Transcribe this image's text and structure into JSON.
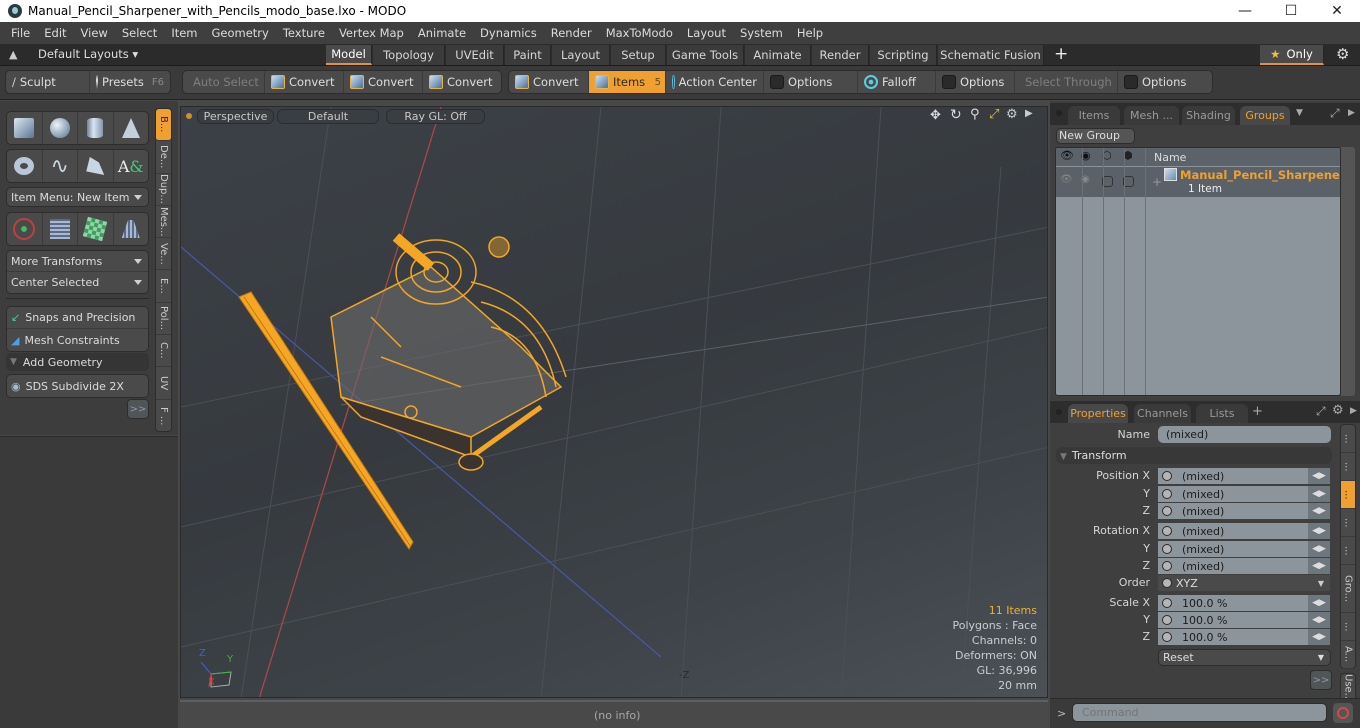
{
  "window": {
    "title": "Manual_Pencil_Sharpener_with_Pencils_modo_base.lxo - MODO",
    "controls": [
      "minimize",
      "maximize",
      "close"
    ]
  },
  "menubar": [
    "File",
    "Edit",
    "View",
    "Select",
    "Item",
    "Geometry",
    "Texture",
    "Vertex Map",
    "Animate",
    "Dynamics",
    "Render",
    "MaxToModo",
    "Layout",
    "System",
    "Help"
  ],
  "layout_bar": {
    "layouts_label": "Default Layouts",
    "tabs": [
      "Model",
      "Topology",
      "UVEdit",
      "Paint",
      "Layout",
      "Setup",
      "Game Tools",
      "Animate",
      "Render",
      "Scripting",
      "Schematic Fusion"
    ],
    "active_tab": "Model",
    "add_label": "+",
    "only_label": "Only"
  },
  "toolbar": {
    "sculpt": "Sculpt",
    "presets": "Presets",
    "presets_hotkey": "F6",
    "auto_select": "Auto Select",
    "convert1": "Convert",
    "convert2": "Convert",
    "convert3": "Convert",
    "convert4": "Convert",
    "items": "Items",
    "items_count": "5",
    "action_center": "Action Center",
    "options1": "Options",
    "falloff": "Falloff",
    "options2": "Options",
    "select_through": "Select Through",
    "options3": "Options"
  },
  "left_panel": {
    "item_menu": "Item Menu: New Item",
    "more_transforms": "More Transforms",
    "center_selected": "Center Selected",
    "snaps": "Snaps and Precision",
    "mesh_constraints": "Mesh Constraints",
    "add_geometry": "Add Geometry",
    "sds_subdivide": "SDS Subdivide 2X",
    "more": ">>",
    "vertical_tabs": [
      "B...",
      "De...",
      "Dup...",
      "Mes...",
      "Ve...",
      "E...",
      "Pol...",
      "C...",
      "UV",
      "F ..."
    ]
  },
  "viewport": {
    "view": "Perspective",
    "shading": "Default",
    "raygl": "Ray GL: Off",
    "stats": {
      "items": "11 Items",
      "polygons": "Polygons : Face",
      "channels": "Channels: 0",
      "deformers": "Deformers: ON",
      "gl": "GL: 36,996",
      "scale": "20 mm"
    },
    "axis_labels": {
      "x": "X",
      "y": "Y",
      "z": "Z",
      "neg_z": "-Z"
    }
  },
  "status_bar": {
    "info": "(no info)"
  },
  "items_panel": {
    "tabs": [
      "Items",
      "Mesh ...",
      "Shading",
      "Groups"
    ],
    "active_tab": "Groups",
    "new_group": "New Group",
    "column_name": "Name",
    "rows": [
      {
        "name": "Manual_Pencil_Sharpener...",
        "sub": "1 Item"
      }
    ]
  },
  "properties_panel": {
    "tabs": [
      "Properties",
      "Channels",
      "Lists"
    ],
    "active_tab": "Properties",
    "name_label": "Name",
    "name_value": "(mixed)",
    "section": "Transform",
    "fields": [
      {
        "label": "Position X",
        "value": "(mixed)"
      },
      {
        "label": "Y",
        "value": "(mixed)"
      },
      {
        "label": "Z",
        "value": "(mixed)"
      },
      {
        "label": "Rotation X",
        "value": "(mixed)"
      },
      {
        "label": "Y",
        "value": "(mixed)"
      },
      {
        "label": "Z",
        "value": "(mixed)"
      }
    ],
    "order_label": "Order",
    "order_value": "XYZ",
    "scale": [
      {
        "label": "Scale X",
        "value": "100.0 %"
      },
      {
        "label": "Y",
        "value": "100.0 %"
      },
      {
        "label": "Z",
        "value": "100.0 %"
      }
    ],
    "reset": "Reset",
    "more": ">>",
    "side_tabs": [
      "...",
      "...",
      "...",
      "...",
      "...",
      "Gro...",
      "...",
      "A...",
      "Use...",
      "..."
    ]
  },
  "command": {
    "prompt": ">",
    "placeholder": "Command"
  },
  "colors": {
    "accent": "#f0a030",
    "selection": "#f5a623"
  }
}
